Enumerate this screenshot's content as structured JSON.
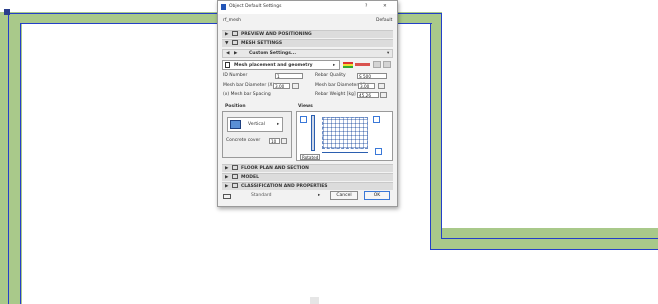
{
  "dialog": {
    "title": "Object Default Settings",
    "help_label": "?",
    "close_label": "✕",
    "object_name": "rf_mesh",
    "default_label": "Default",
    "sections": {
      "preview": "PREVIEW AND POSITIONING",
      "mesh_settings": "MESH SETTINGS",
      "floor_plan": "FLOOR PLAN AND SECTION",
      "model": "MODEL",
      "classification": "CLASSIFICATION AND PROPERTIES"
    },
    "custom_settings": "Custom Settings...",
    "subpanel": "Mesh placement and geometry",
    "fields": {
      "id_number_label": "ID Number",
      "id_number_value": "1",
      "rebar_quality_label": "Rebar Quality",
      "rebar_quality_value": "S 500",
      "mesh_bar_diam_x_label": "Mesh bar Diameter (X)",
      "mesh_bar_diam_x_value": "3,00",
      "mesh_bar_diam_y_label": "Mesh bar Diameter (Y)",
      "mesh_bar_diam_y_value": "3,00",
      "mesh_bar_spacing_label": "(x) Mesh bar Spacing",
      "rebar_weight_label": "Rebar Weight [kg]",
      "rebar_weight_value": "45,26"
    },
    "position": {
      "heading": "Position",
      "selector_label": "Vertical",
      "concrete_cover_label": "Concrete cover",
      "concrete_cover_value": "10"
    },
    "views": {
      "heading": "Views",
      "selector_label": "Rotated"
    },
    "footer": {
      "layer_value": "Standard",
      "cancel_label": "Cancel",
      "ok_label": "OK"
    }
  },
  "colors": {
    "wall_fill": "#a9c98a",
    "wall_edge": "#2440c8",
    "ok_border": "#3a78d8"
  }
}
